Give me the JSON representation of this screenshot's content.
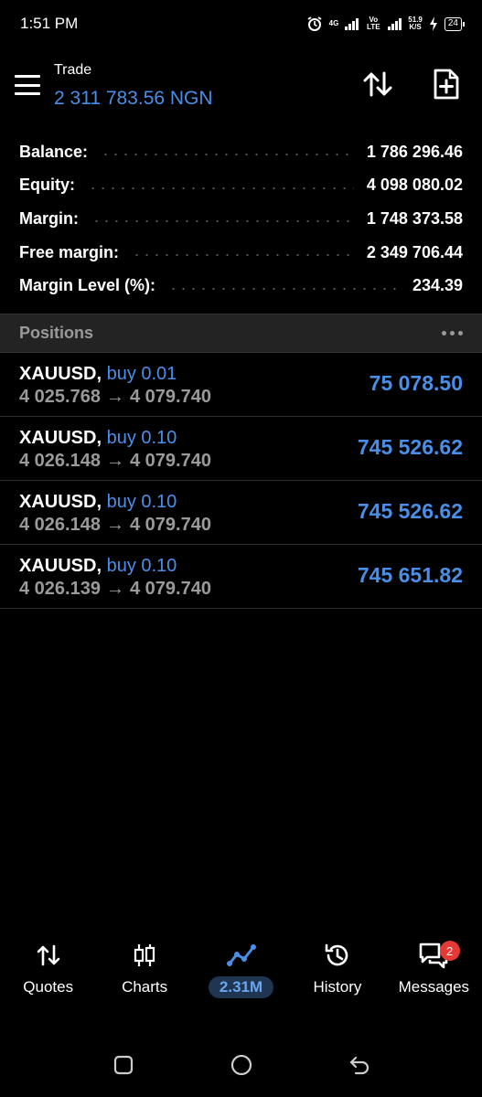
{
  "status_bar": {
    "time": "1:51 PM",
    "net_4g": "4G",
    "volte": "Vo LTE",
    "speed_value": "51.9",
    "speed_unit": "K/S",
    "battery": "24"
  },
  "header": {
    "title": "Trade",
    "balance": "2 311 783.56 NGN"
  },
  "summary": [
    {
      "label": "Balance:",
      "value": "1 786 296.46"
    },
    {
      "label": "Equity:",
      "value": "4 098 080.02"
    },
    {
      "label": "Margin:",
      "value": "1 748 373.58"
    },
    {
      "label": "Free margin:",
      "value": "2 349 706.44"
    },
    {
      "label": "Margin Level (%):",
      "value": "234.39"
    }
  ],
  "positions": {
    "title": "Positions",
    "items": [
      {
        "symbol": "XAUUSD,",
        "side": "buy 0.01",
        "open": "4 025.768",
        "arrow": "→",
        "current": "4 079.740",
        "profit": "75 078.50"
      },
      {
        "symbol": "XAUUSD,",
        "side": "buy 0.10",
        "open": "4 026.148",
        "arrow": "→",
        "current": "4 079.740",
        "profit": "745 526.62"
      },
      {
        "symbol": "XAUUSD,",
        "side": "buy 0.10",
        "open": "4 026.148",
        "arrow": "→",
        "current": "4 079.740",
        "profit": "745 526.62"
      },
      {
        "symbol": "XAUUSD,",
        "side": "buy 0.10",
        "open": "4 026.139",
        "arrow": "→",
        "current": "4 079.740",
        "profit": "745 651.82"
      }
    ]
  },
  "nav": [
    {
      "label": "Quotes",
      "icon": "quotes-arrows-icon"
    },
    {
      "label": "Charts",
      "icon": "candlestick-icon"
    },
    {
      "label": "2.31M",
      "icon": "trade-line-icon",
      "active": true
    },
    {
      "label": "History",
      "icon": "history-clock-icon"
    },
    {
      "label": "Messages",
      "icon": "chat-bubbles-icon",
      "badge": "2"
    }
  ],
  "colors": {
    "accent": "#4a8fe7",
    "background": "#000000",
    "muted": "#9a9a9a",
    "section_bg": "#232323",
    "badge": "#e53935"
  }
}
